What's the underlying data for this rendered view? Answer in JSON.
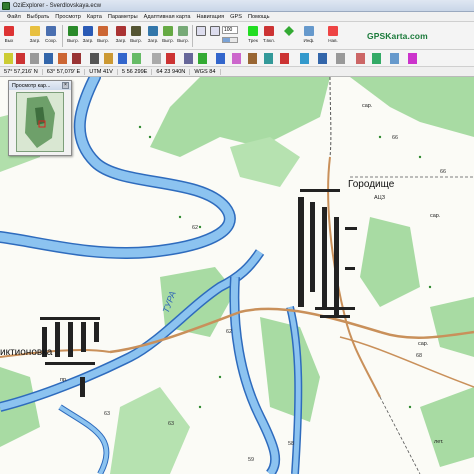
{
  "window": {
    "title": "OziExplorer - Sverdlovskaya.ecw"
  },
  "menu": {
    "items": [
      "Файл",
      "Выбрать",
      "Просмотр",
      "Карта",
      "Параметры",
      "Адаптивная карта",
      "Навигация",
      "GPS",
      "Помощь"
    ]
  },
  "toolbar": {
    "buttons": [
      {
        "label": "Вых"
      },
      {
        "label": "Загр."
      },
      {
        "label": "Сохр."
      },
      {
        "label": "Выгр."
      },
      {
        "label": "Загр."
      },
      {
        "label": "Выгр."
      },
      {
        "label": "Загр."
      },
      {
        "label": "Выгр."
      },
      {
        "label": "Загр."
      },
      {
        "label": "Выгр."
      },
      {
        "label": "Выгр."
      },
      {
        "label": "Выгр."
      },
      {
        "label": "Выгр."
      },
      {
        "label": "Выгр."
      }
    ],
    "zoom_value": "100",
    "right_buttons": [
      {
        "label": "Трек"
      },
      {
        "label": "Т.вкл."
      },
      {
        "label": "Инф."
      },
      {
        "label": "Нав."
      }
    ],
    "brand": "GPSKarta.com"
  },
  "status": {
    "fields": [
      "57° 57,216' N",
      "63° 57,079' E",
      "UTM 41V",
      "5 56 299E",
      "64 23 940N",
      "WGS 84"
    ]
  },
  "overview_window": {
    "title": "Просмотр кар..."
  },
  "map": {
    "places": [
      {
        "name": "Городище",
        "kind": "town"
      },
      {
        "name": "иктионовка",
        "kind": "town"
      },
      {
        "name": "ТУРА",
        "kind": "river"
      },
      {
        "name": "сар.",
        "kind": "small"
      },
      {
        "name": "сар.",
        "kind": "small"
      },
      {
        "name": "сар.",
        "kind": "small"
      },
      {
        "name": "АЦЗ",
        "kind": "small"
      },
      {
        "name": "лет.",
        "kind": "small"
      },
      {
        "name": "пр.",
        "kind": "small"
      }
    ],
    "numbers": [
      "66",
      "62",
      "62",
      "63",
      "63",
      "58",
      "59",
      "68",
      "66"
    ]
  },
  "colors": {
    "river": "#8cc3f0",
    "river_edge": "#2e6bbd",
    "forest": "#9fd99a",
    "road": "#c9905a",
    "building": "#222222"
  }
}
